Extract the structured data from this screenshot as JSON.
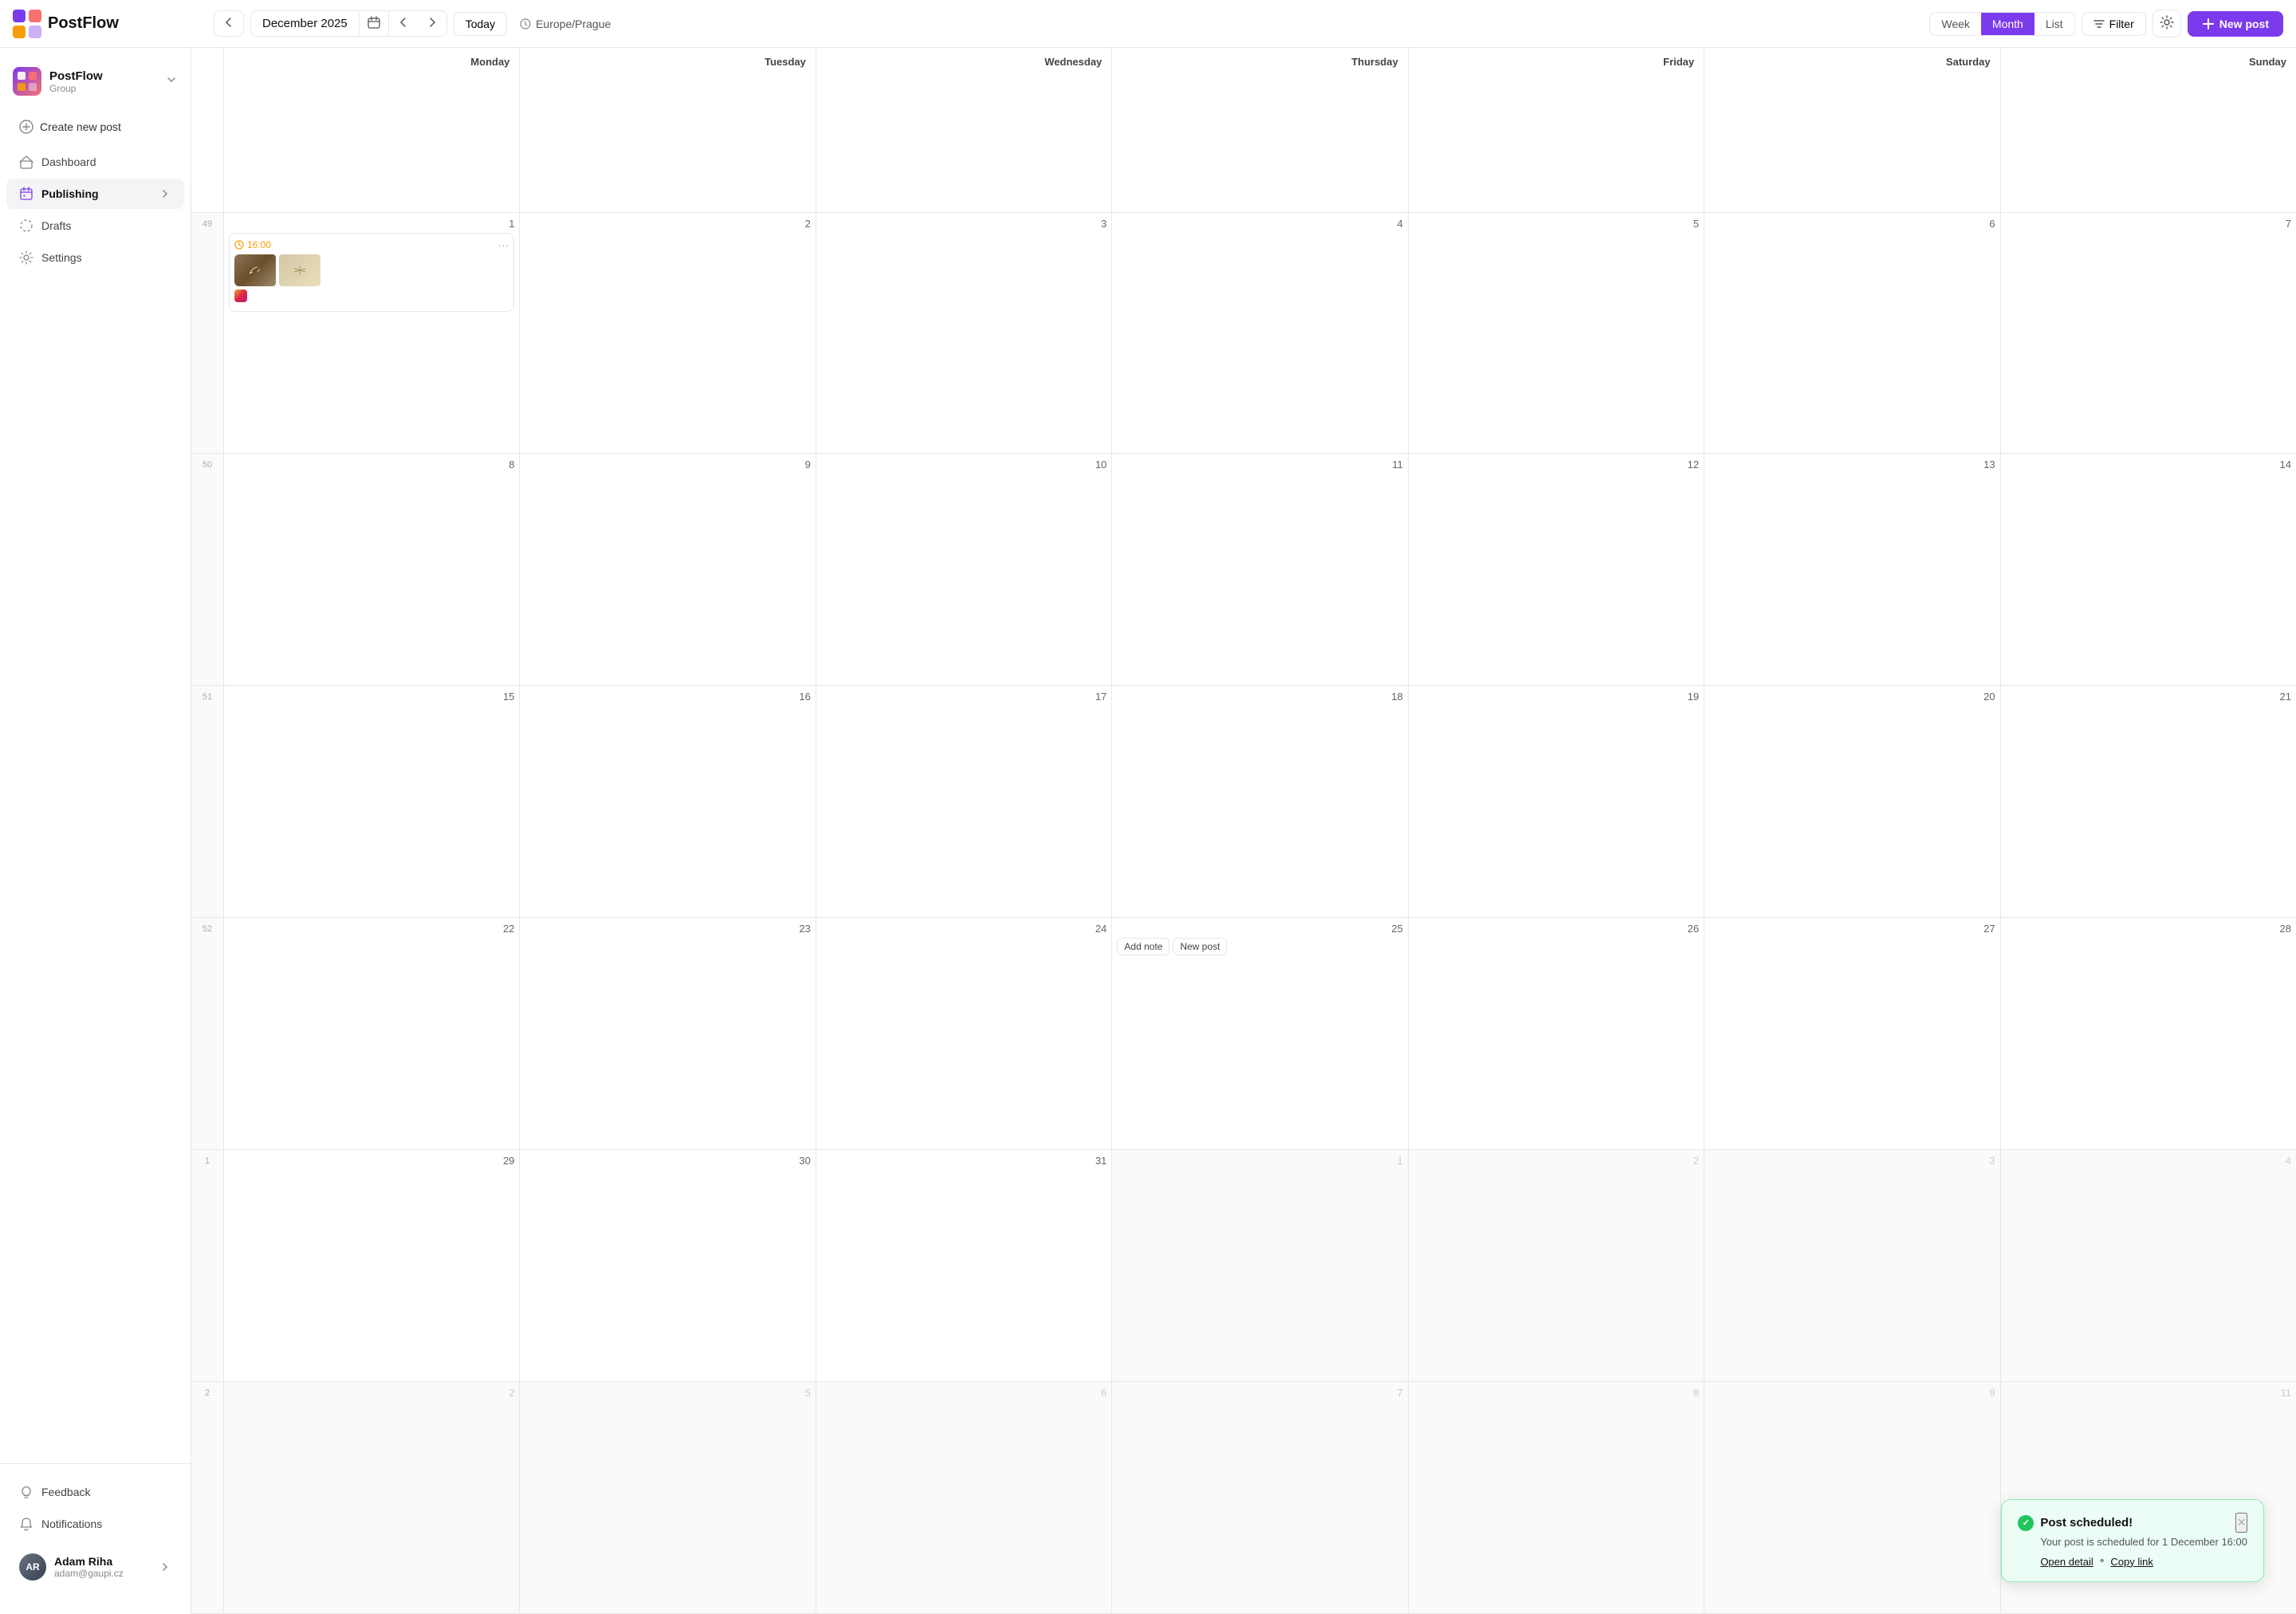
{
  "app": {
    "name": "PostFlow",
    "logo_colors": [
      "#7c3aed",
      "#f87171",
      "#f59e0b"
    ]
  },
  "header": {
    "date_display": "December 2025",
    "today_label": "Today",
    "timezone": "Europe/Prague",
    "view_options": [
      "Week",
      "Month",
      "List"
    ],
    "active_view": "Month",
    "filter_label": "Filter",
    "new_post_label": "New post"
  },
  "sidebar": {
    "workspace_name": "PostFlow",
    "workspace_type": "Group",
    "create_label": "Create new post",
    "nav_items": [
      {
        "id": "dashboard",
        "label": "Dashboard",
        "icon": "house"
      },
      {
        "id": "publishing",
        "label": "Publishing",
        "icon": "calendar",
        "active": true
      },
      {
        "id": "drafts",
        "label": "Drafts",
        "icon": "circle-dashed"
      },
      {
        "id": "settings",
        "label": "Settings",
        "icon": "gear"
      }
    ],
    "bottom_items": [
      {
        "id": "feedback",
        "label": "Feedback",
        "icon": "lightbulb"
      },
      {
        "id": "notifications",
        "label": "Notifications",
        "icon": "bell"
      }
    ],
    "user": {
      "name": "Adam Riha",
      "email": "adam@gaupi.cz",
      "avatar_initials": "AR"
    }
  },
  "calendar": {
    "day_headers": [
      "Monday",
      "Tuesday",
      "Wednesday",
      "Thursday",
      "Friday",
      "Saturday",
      "Sunday"
    ],
    "weeks": [
      {
        "week_num": "49",
        "days": [
          {
            "date": "1",
            "month": "current",
            "has_post": true,
            "post_time": "16:00"
          },
          {
            "date": "2",
            "month": "current"
          },
          {
            "date": "3",
            "month": "current"
          },
          {
            "date": "4",
            "month": "current"
          },
          {
            "date": "5",
            "month": "current"
          },
          {
            "date": "6",
            "month": "current"
          },
          {
            "date": "7",
            "month": "current"
          }
        ]
      },
      {
        "week_num": "50",
        "days": [
          {
            "date": "8",
            "month": "current"
          },
          {
            "date": "9",
            "month": "current"
          },
          {
            "date": "10",
            "month": "current"
          },
          {
            "date": "11",
            "month": "current"
          },
          {
            "date": "12",
            "month": "current"
          },
          {
            "date": "13",
            "month": "current"
          },
          {
            "date": "14",
            "month": "current"
          }
        ]
      },
      {
        "week_num": "51",
        "days": [
          {
            "date": "15",
            "month": "current"
          },
          {
            "date": "16",
            "month": "current"
          },
          {
            "date": "17",
            "month": "current"
          },
          {
            "date": "18",
            "month": "current"
          },
          {
            "date": "19",
            "month": "current"
          },
          {
            "date": "20",
            "month": "current"
          },
          {
            "date": "21",
            "month": "current"
          }
        ]
      },
      {
        "week_num": "52",
        "days": [
          {
            "date": "22",
            "month": "current"
          },
          {
            "date": "23",
            "month": "current"
          },
          {
            "date": "24",
            "month": "current"
          },
          {
            "date": "25",
            "month": "current",
            "has_actions": true,
            "action_add_note": "Add note",
            "action_new_post": "New post"
          },
          {
            "date": "26",
            "month": "current"
          },
          {
            "date": "27",
            "month": "current"
          },
          {
            "date": "28",
            "month": "current"
          }
        ]
      },
      {
        "week_num": "1",
        "days": [
          {
            "date": "29",
            "month": "current"
          },
          {
            "date": "30",
            "month": "current"
          },
          {
            "date": "31",
            "month": "current"
          },
          {
            "date": "1",
            "month": "other"
          },
          {
            "date": "2",
            "month": "other"
          },
          {
            "date": "3",
            "month": "other"
          },
          {
            "date": "4",
            "month": "other"
          }
        ]
      },
      {
        "week_num": "2",
        "days": [
          {
            "date": "2",
            "month": "other"
          },
          {
            "date": "5",
            "month": "other"
          },
          {
            "date": "6",
            "month": "other"
          },
          {
            "date": "7",
            "month": "other"
          },
          {
            "date": "8",
            "month": "other"
          },
          {
            "date": "9",
            "month": "other"
          },
          {
            "date": "11",
            "month": "other"
          }
        ]
      }
    ]
  },
  "toast": {
    "title": "Post scheduled!",
    "body": "Your post is scheduled for 1 December 16:00",
    "action1": "Open detail",
    "action2": "Copy link",
    "dot": "•"
  },
  "post_card": {
    "time": "16:00"
  }
}
